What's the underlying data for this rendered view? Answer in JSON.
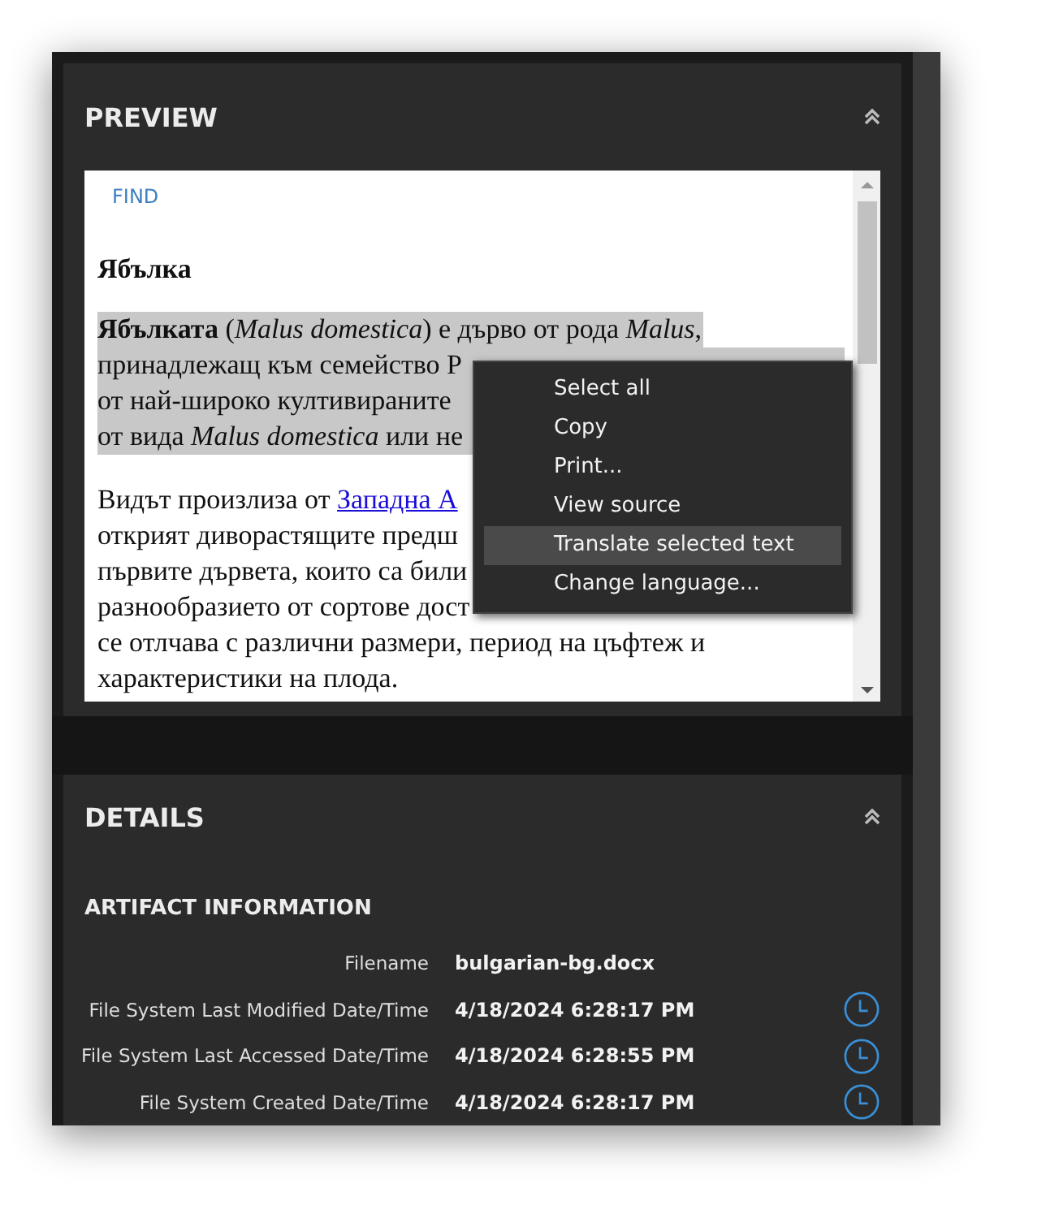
{
  "preview": {
    "title": "PREVIEW",
    "find": "FIND",
    "heading": "Ябълка",
    "paragraphs": [
      {
        "highlighted": true,
        "lines": [
          {
            "text": "**Ябълката** (*Malus domestica*) е дърво от рода *Malus*,"
          },
          {
            "text": "принадлежащ към семейство Р"
          },
          {
            "text": "от най-широко култивираните"
          },
          {
            "text": "от вида *Malus domestica* или не"
          }
        ]
      },
      {
        "highlighted": false,
        "lines": [
          {
            "text": "Видът произлиза от ",
            "link": "Западна А"
          },
          {
            "text": "открият диворастящите предш"
          },
          {
            "text": "първите дървета, които са били"
          },
          {
            "text": "разнообразието от сортове дост"
          },
          {
            "text": "се отлчава с различни размери, период на цъфтеж и"
          },
          {
            "text": "характеристики на плода."
          }
        ]
      }
    ],
    "context_menu": [
      {
        "label": "Select all",
        "selected": false
      },
      {
        "label": "Copy",
        "selected": false
      },
      {
        "label": "Print...",
        "selected": false
      },
      {
        "label": "View source",
        "selected": false
      },
      {
        "label": "Translate selected text",
        "selected": true
      },
      {
        "label": "Change language...",
        "selected": false
      }
    ]
  },
  "details": {
    "title": "DETAILS",
    "section": "ARTIFACT INFORMATION",
    "rows": [
      {
        "kind": "text",
        "label": "Filename",
        "value": "bulgarian-bg.docx"
      },
      {
        "kind": "datetime",
        "label": "File System Last Modified Date/Time",
        "value": "4/18/2024 6:28:17 PM"
      },
      {
        "kind": "datetime",
        "label": "File System Last Accessed Date/Time",
        "value": "4/18/2024 6:28:55 PM"
      },
      {
        "kind": "datetime",
        "label": "File System Created Date/Time",
        "value": "4/18/2024 6:28:17 PM"
      }
    ]
  }
}
